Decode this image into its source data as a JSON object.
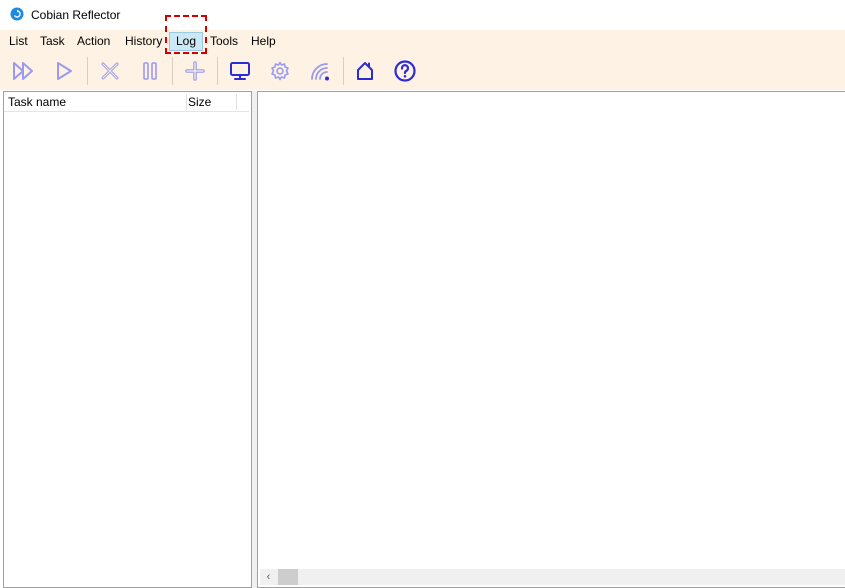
{
  "window": {
    "title": "Cobian Reflector"
  },
  "menu": {
    "items": [
      {
        "label": "List"
      },
      {
        "label": "Task"
      },
      {
        "label": "Action"
      },
      {
        "label": "History"
      },
      {
        "label": "Log",
        "selected": true
      },
      {
        "label": "Tools"
      },
      {
        "label": "Help"
      }
    ]
  },
  "toolbar": {
    "buttons": [
      {
        "icon": "run-all-icon"
      },
      {
        "icon": "run-icon"
      },
      {
        "icon": "cancel-icon"
      },
      {
        "icon": "pause-icon"
      },
      {
        "icon": "add-task-icon"
      },
      {
        "icon": "monitor-icon"
      },
      {
        "icon": "settings-gear-icon"
      },
      {
        "icon": "wireless-icon"
      },
      {
        "icon": "home-icon"
      },
      {
        "icon": "help-icon"
      }
    ]
  },
  "task_list": {
    "columns": [
      "Task name",
      "Size"
    ],
    "rows": []
  },
  "colors": {
    "icon_blue": "#2c2cd6",
    "icon_faded": "#9a9af0",
    "menu_background": "#fdf2e3",
    "selected_menu": "#cce8f4",
    "annotation_red": "#d40000"
  }
}
